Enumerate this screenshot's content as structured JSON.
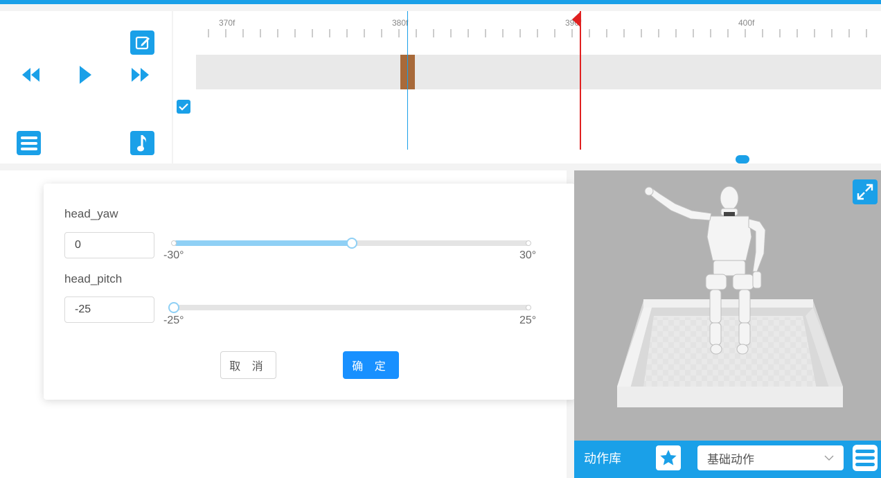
{
  "timeline": {
    "tick_labels": [
      "370f",
      "380f",
      "390f",
      "400f"
    ],
    "track_enabled": true
  },
  "icons": {
    "edit": "edit-icon",
    "rewind": "rewind-icon",
    "play": "play-icon",
    "fast_forward": "fast-forward-icon",
    "menu": "menu-icon",
    "music": "music-note-icon",
    "checkbox": "checkbox-checked-icon",
    "expand": "expand-icon",
    "star": "star-icon",
    "chevron": "chevron-down-icon"
  },
  "dialog": {
    "params": [
      {
        "label": "head_yaw",
        "value": "0",
        "min_label": "-30°",
        "max_label": "30°",
        "level": 0.5
      },
      {
        "label": "head_pitch",
        "value": "-25",
        "min_label": "-25°",
        "max_label": "25°",
        "level": 0.0
      }
    ],
    "cancel_label": "取 消",
    "confirm_label": "确 定"
  },
  "library": {
    "label": "动作库",
    "selected": "基础动作"
  },
  "colors": {
    "accent": "#1aa0e8",
    "primary_button": "#1890ff",
    "playhead": "#e02020",
    "keyframe": "#a86a3a",
    "slider_fill": "#8fd0f5"
  }
}
